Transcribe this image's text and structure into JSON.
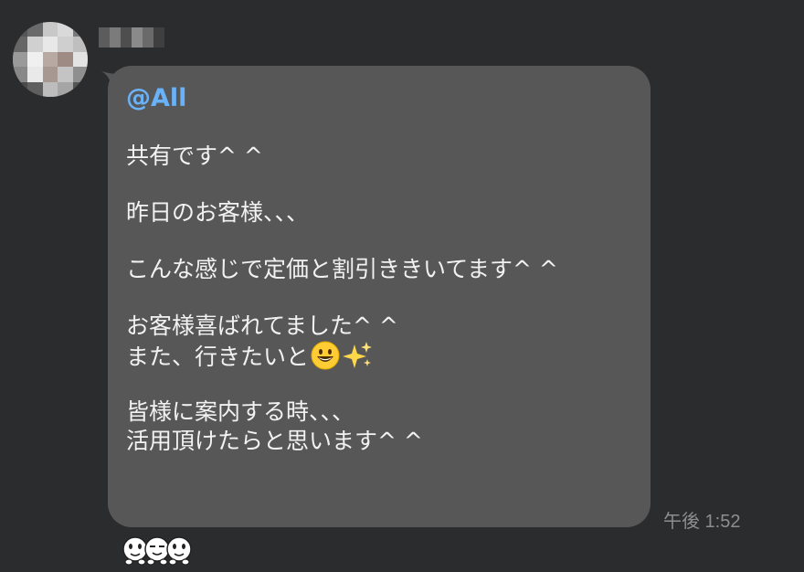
{
  "message": {
    "mention": "@All",
    "lines": {
      "l1": "共有です^ ^",
      "l2": "昨日のお客様、、、",
      "l3": "こんな感じで定価と割引ききいてます^ ^",
      "l4": "お客様喜ばれてました^ ^",
      "l5": "また、行きたいと",
      "l6": "皆様に案内する時、、、",
      "l7": "活用頂けたらと思います^ ^"
    },
    "emojis": [
      "grinning-face-icon",
      "sparkles-icon"
    ],
    "timestamp": "午後 1:52"
  },
  "reactions": [
    "character-face-icon",
    "character-face-icon",
    "character-face-icon"
  ],
  "colors": {
    "background": "#2b2c2e",
    "bubble": "#575757",
    "mention": "#6ab2f7",
    "text": "#f2f2f2",
    "timestamp": "#8e8e8e"
  }
}
